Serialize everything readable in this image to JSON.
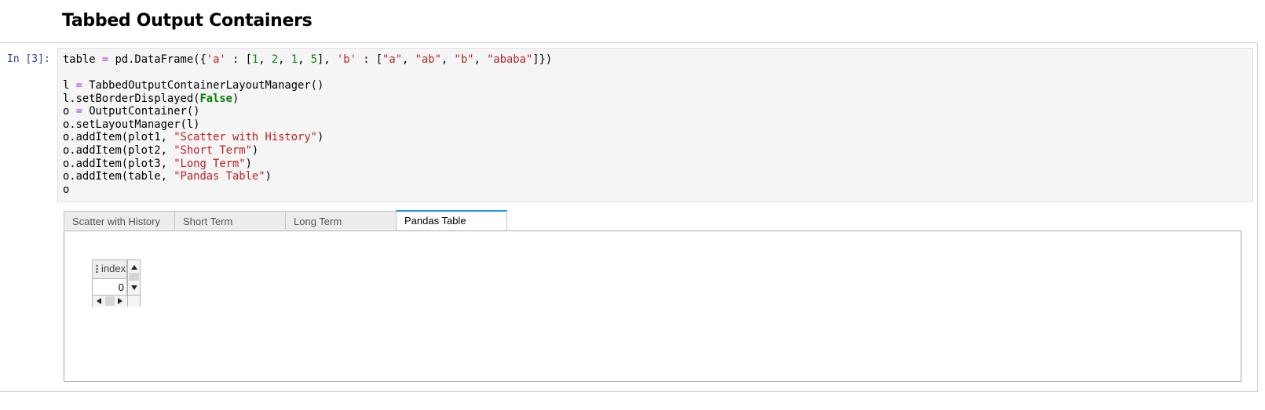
{
  "heading": "Tabbed Output Containers",
  "cell": {
    "prompt": "In [3]:",
    "code_lines": [
      "table = pd.DataFrame({'a' : [1, 2, 1, 5], 'b' : [\"a\", \"ab\", \"b\", \"ababa\"]})",
      "",
      "l = TabbedOutputContainerLayoutManager()",
      "l.setBorderDisplayed(False)",
      "o = OutputContainer()",
      "o.setLayoutManager(l)",
      "o.addItem(plot1, \"Scatter with History\")",
      "o.addItem(plot2, \"Short Term\")",
      "o.addItem(plot3, \"Long Term\")",
      "o.addItem(table, \"Pandas Table\")",
      "o"
    ]
  },
  "tabs": [
    {
      "label": "Scatter with History",
      "active": false
    },
    {
      "label": "Short Term",
      "active": false
    },
    {
      "label": "Long Term",
      "active": false
    },
    {
      "label": "Pandas Table",
      "active": true
    }
  ],
  "table": {
    "header": "index",
    "rows": [
      "0"
    ]
  },
  "colors": {
    "prompt": "#303f9f",
    "active_tab_accent": "#2196f3",
    "string": "#ba2121",
    "number": "#008800",
    "operator": "#aa22ff"
  }
}
